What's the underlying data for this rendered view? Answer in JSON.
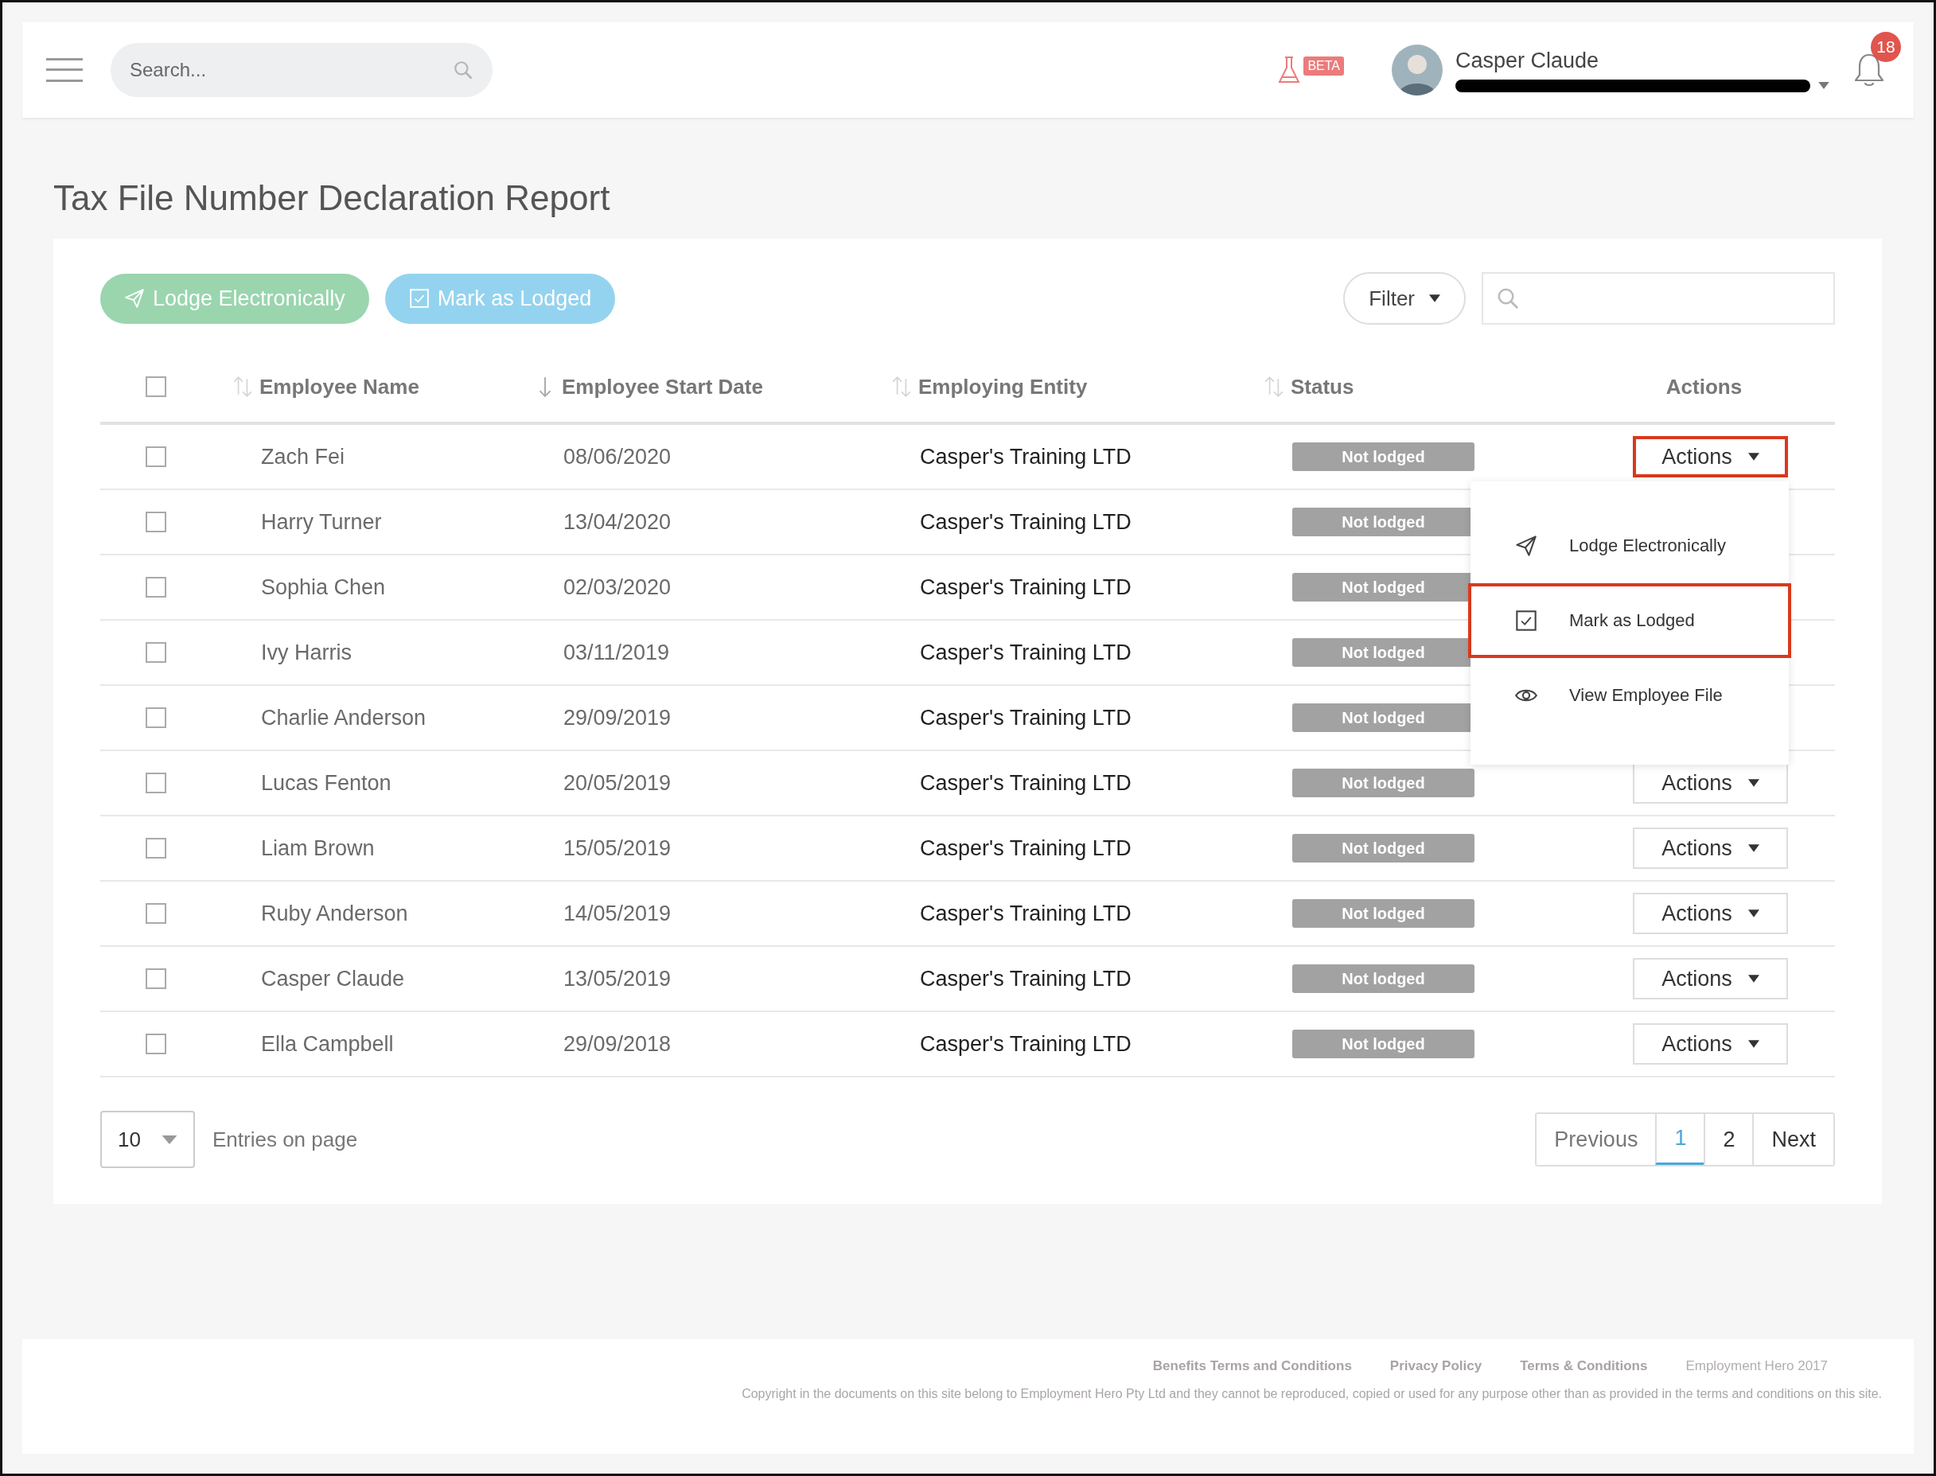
{
  "header": {
    "search": {
      "placeholder": "Search..."
    },
    "beta_badge": "BETA",
    "user": {
      "name": "Casper Claude"
    },
    "notifications": "18"
  },
  "title": "Tax File Number Declaration Report",
  "toolbar": {
    "buttons": [
      {
        "label": "Lodge Electronically",
        "kind": "lodge"
      },
      {
        "label": "Mark as Lodged",
        "kind": "mark"
      }
    ],
    "filter": "Filter"
  },
  "table": {
    "select_all": {
      "checked": false
    },
    "columns": [
      {
        "label": "Employee Name",
        "sortable": true,
        "sorted": false
      },
      {
        "label": "Employee Start Date",
        "sortable": true,
        "sorted": true
      },
      {
        "label": "Employing Entity",
        "sortable": true,
        "sorted": false
      },
      {
        "label": "Status",
        "sortable": true,
        "sorted": false
      },
      {
        "label": "Actions",
        "sortable": false
      }
    ],
    "rows": [
      {
        "checked": false,
        "name": "Zach Fei",
        "start_date": "08/06/2020",
        "entity": "Casper's Training LTD",
        "status": "Not lodged",
        "action": {
          "label": "Actions",
          "highlighted": true
        }
      },
      {
        "checked": false,
        "name": "Harry Turner",
        "start_date": "13/04/2020",
        "entity": "Casper's Training LTD",
        "status": "Not lodged"
      },
      {
        "checked": false,
        "name": "Sophia Chen",
        "start_date": "02/03/2020",
        "entity": "Casper's Training LTD",
        "status": "Not lodged"
      },
      {
        "checked": false,
        "name": "Ivy Harris",
        "start_date": "03/11/2019",
        "entity": "Casper's Training LTD",
        "status": "Not lodged"
      },
      {
        "checked": false,
        "name": "Charlie Anderson",
        "start_date": "29/09/2019",
        "entity": "Casper's Training LTD",
        "status": "Not lodged"
      },
      {
        "checked": false,
        "name": "Lucas Fenton",
        "start_date": "20/05/2019",
        "entity": "Casper's Training LTD",
        "status": "Not lodged",
        "action": {
          "label": "Actions",
          "highlighted": false
        }
      },
      {
        "checked": false,
        "name": "Liam Brown",
        "start_date": "15/05/2019",
        "entity": "Casper's Training LTD",
        "status": "Not lodged",
        "action": {
          "label": "Actions",
          "highlighted": false
        }
      },
      {
        "checked": false,
        "name": "Ruby Anderson",
        "start_date": "14/05/2019",
        "entity": "Casper's Training LTD",
        "status": "Not lodged",
        "action": {
          "label": "Actions",
          "highlighted": false
        }
      },
      {
        "checked": false,
        "name": "Casper Claude",
        "start_date": "13/05/2019",
        "entity": "Casper's Training LTD",
        "status": "Not lodged",
        "action": {
          "label": "Actions",
          "highlighted": false
        }
      },
      {
        "checked": false,
        "name": "Ella Campbell",
        "start_date": "29/09/2018",
        "entity": "Casper's Training LTD",
        "status": "Not lodged",
        "action": {
          "label": "Actions",
          "highlighted": false
        }
      }
    ]
  },
  "action_menu": {
    "items": [
      {
        "label": "Lodge Electronically",
        "kind": "send",
        "highlighted": false
      },
      {
        "label": "Mark as Lodged",
        "kind": "check",
        "highlighted": true
      },
      {
        "label": "View Employee File",
        "kind": "view",
        "highlighted": false
      }
    ]
  },
  "pagination": {
    "per_page": "10",
    "per_page_label": "Entries on page",
    "pages": [
      {
        "label": "Previous",
        "selected": false
      },
      {
        "label": "1",
        "selected": true
      },
      {
        "label": "2",
        "selected": false
      },
      {
        "label": "Next",
        "selected": false
      }
    ]
  },
  "footer": {
    "links": [
      "Benefits Terms and Conditions",
      "Privacy Policy",
      "Terms & Conditions"
    ],
    "brand": "Employment Hero 2017",
    "copyright": "Copyright in the documents on this site belong to Employment Hero Pty Ltd and they cannot be reproduced, copied or used for any purpose other than as provided in the terms and conditions on this site."
  }
}
